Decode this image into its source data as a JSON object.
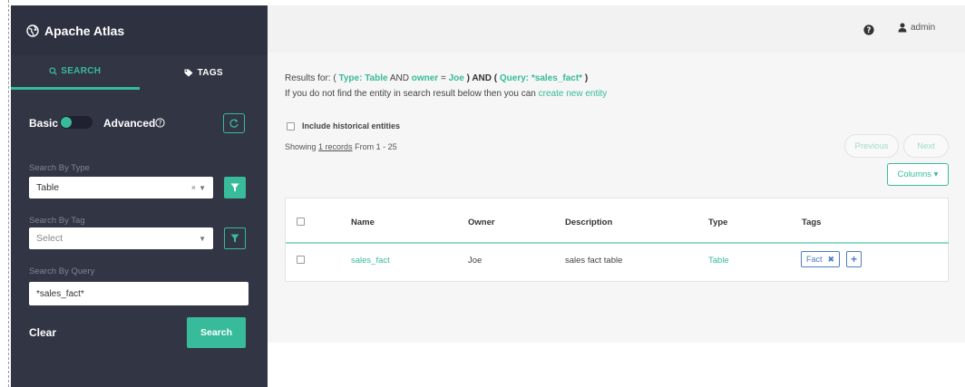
{
  "app": {
    "title": "Apache Atlas"
  },
  "sidebar": {
    "tabs": [
      {
        "label": "SEARCH",
        "active": true
      },
      {
        "label": "TAGS",
        "active": false
      }
    ],
    "basic_label": "Basic",
    "advanced_label": "Advanced",
    "search_by_type": {
      "label": "Search By Type",
      "value": "Table",
      "clear_glyph": "×"
    },
    "search_by_tag": {
      "label": "Search By Tag",
      "placeholder": "Select"
    },
    "search_by_query": {
      "label": "Search By Query",
      "value": "*sales_fact*"
    },
    "clear_label": "Clear",
    "search_button": "Search"
  },
  "header": {
    "user": "admin"
  },
  "results": {
    "prefix": "Results for: (",
    "type_label": "Type:",
    "type_value": "Table",
    "and1": "AND",
    "owner_key": "owner",
    "owner_op": "=",
    "owner_value": "Joe",
    "close_and": ") AND (",
    "query_label": "Query:",
    "query_value": "*sales_fact*",
    "suffix": ")",
    "hint_text": "If you do not find the entity in search result below then you can",
    "hint_link": "create new entity",
    "include_historical": "Include historical entities",
    "showing_prefix": "Showing",
    "showing_link": "1 records",
    "showing_suffix": "From 1 - 25",
    "previous": "Previous",
    "next": "Next",
    "columns": "Columns ▾"
  },
  "table": {
    "headers": [
      "Name",
      "Owner",
      "Description",
      "Type",
      "Tags"
    ],
    "rows": [
      {
        "name": "sales_fact",
        "owner": "Joe",
        "description": "sales fact table",
        "type": "Table",
        "tags": [
          "Fact"
        ]
      }
    ]
  },
  "colors": {
    "accent": "#37bb9b",
    "sidebar": "#323544",
    "tag": "#4d7cc7"
  }
}
